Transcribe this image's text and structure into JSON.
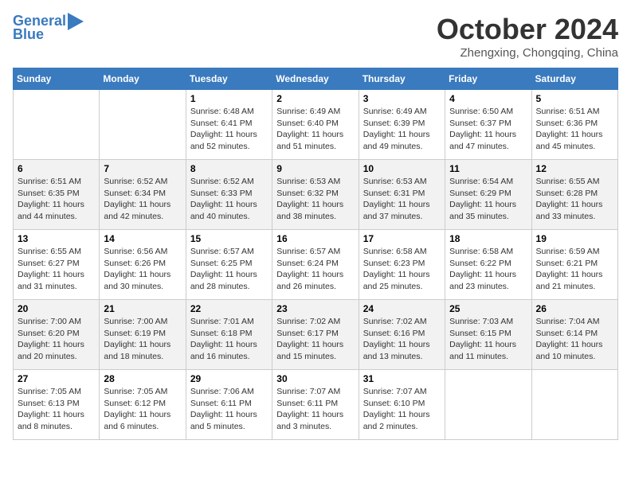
{
  "logo": {
    "line1": "General",
    "line2": "Blue"
  },
  "title": "October 2024",
  "location": "Zhengxing, Chongqing, China",
  "weekdays": [
    "Sunday",
    "Monday",
    "Tuesday",
    "Wednesday",
    "Thursday",
    "Friday",
    "Saturday"
  ],
  "weeks": [
    [
      {
        "day": "",
        "info": ""
      },
      {
        "day": "",
        "info": ""
      },
      {
        "day": "1",
        "info": "Sunrise: 6:48 AM\nSunset: 6:41 PM\nDaylight: 11 hours and 52 minutes."
      },
      {
        "day": "2",
        "info": "Sunrise: 6:49 AM\nSunset: 6:40 PM\nDaylight: 11 hours and 51 minutes."
      },
      {
        "day": "3",
        "info": "Sunrise: 6:49 AM\nSunset: 6:39 PM\nDaylight: 11 hours and 49 minutes."
      },
      {
        "day": "4",
        "info": "Sunrise: 6:50 AM\nSunset: 6:37 PM\nDaylight: 11 hours and 47 minutes."
      },
      {
        "day": "5",
        "info": "Sunrise: 6:51 AM\nSunset: 6:36 PM\nDaylight: 11 hours and 45 minutes."
      }
    ],
    [
      {
        "day": "6",
        "info": "Sunrise: 6:51 AM\nSunset: 6:35 PM\nDaylight: 11 hours and 44 minutes."
      },
      {
        "day": "7",
        "info": "Sunrise: 6:52 AM\nSunset: 6:34 PM\nDaylight: 11 hours and 42 minutes."
      },
      {
        "day": "8",
        "info": "Sunrise: 6:52 AM\nSunset: 6:33 PM\nDaylight: 11 hours and 40 minutes."
      },
      {
        "day": "9",
        "info": "Sunrise: 6:53 AM\nSunset: 6:32 PM\nDaylight: 11 hours and 38 minutes."
      },
      {
        "day": "10",
        "info": "Sunrise: 6:53 AM\nSunset: 6:31 PM\nDaylight: 11 hours and 37 minutes."
      },
      {
        "day": "11",
        "info": "Sunrise: 6:54 AM\nSunset: 6:29 PM\nDaylight: 11 hours and 35 minutes."
      },
      {
        "day": "12",
        "info": "Sunrise: 6:55 AM\nSunset: 6:28 PM\nDaylight: 11 hours and 33 minutes."
      }
    ],
    [
      {
        "day": "13",
        "info": "Sunrise: 6:55 AM\nSunset: 6:27 PM\nDaylight: 11 hours and 31 minutes."
      },
      {
        "day": "14",
        "info": "Sunrise: 6:56 AM\nSunset: 6:26 PM\nDaylight: 11 hours and 30 minutes."
      },
      {
        "day": "15",
        "info": "Sunrise: 6:57 AM\nSunset: 6:25 PM\nDaylight: 11 hours and 28 minutes."
      },
      {
        "day": "16",
        "info": "Sunrise: 6:57 AM\nSunset: 6:24 PM\nDaylight: 11 hours and 26 minutes."
      },
      {
        "day": "17",
        "info": "Sunrise: 6:58 AM\nSunset: 6:23 PM\nDaylight: 11 hours and 25 minutes."
      },
      {
        "day": "18",
        "info": "Sunrise: 6:58 AM\nSunset: 6:22 PM\nDaylight: 11 hours and 23 minutes."
      },
      {
        "day": "19",
        "info": "Sunrise: 6:59 AM\nSunset: 6:21 PM\nDaylight: 11 hours and 21 minutes."
      }
    ],
    [
      {
        "day": "20",
        "info": "Sunrise: 7:00 AM\nSunset: 6:20 PM\nDaylight: 11 hours and 20 minutes."
      },
      {
        "day": "21",
        "info": "Sunrise: 7:00 AM\nSunset: 6:19 PM\nDaylight: 11 hours and 18 minutes."
      },
      {
        "day": "22",
        "info": "Sunrise: 7:01 AM\nSunset: 6:18 PM\nDaylight: 11 hours and 16 minutes."
      },
      {
        "day": "23",
        "info": "Sunrise: 7:02 AM\nSunset: 6:17 PM\nDaylight: 11 hours and 15 minutes."
      },
      {
        "day": "24",
        "info": "Sunrise: 7:02 AM\nSunset: 6:16 PM\nDaylight: 11 hours and 13 minutes."
      },
      {
        "day": "25",
        "info": "Sunrise: 7:03 AM\nSunset: 6:15 PM\nDaylight: 11 hours and 11 minutes."
      },
      {
        "day": "26",
        "info": "Sunrise: 7:04 AM\nSunset: 6:14 PM\nDaylight: 11 hours and 10 minutes."
      }
    ],
    [
      {
        "day": "27",
        "info": "Sunrise: 7:05 AM\nSunset: 6:13 PM\nDaylight: 11 hours and 8 minutes."
      },
      {
        "day": "28",
        "info": "Sunrise: 7:05 AM\nSunset: 6:12 PM\nDaylight: 11 hours and 6 minutes."
      },
      {
        "day": "29",
        "info": "Sunrise: 7:06 AM\nSunset: 6:11 PM\nDaylight: 11 hours and 5 minutes."
      },
      {
        "day": "30",
        "info": "Sunrise: 7:07 AM\nSunset: 6:11 PM\nDaylight: 11 hours and 3 minutes."
      },
      {
        "day": "31",
        "info": "Sunrise: 7:07 AM\nSunset: 6:10 PM\nDaylight: 11 hours and 2 minutes."
      },
      {
        "day": "",
        "info": ""
      },
      {
        "day": "",
        "info": ""
      }
    ]
  ]
}
